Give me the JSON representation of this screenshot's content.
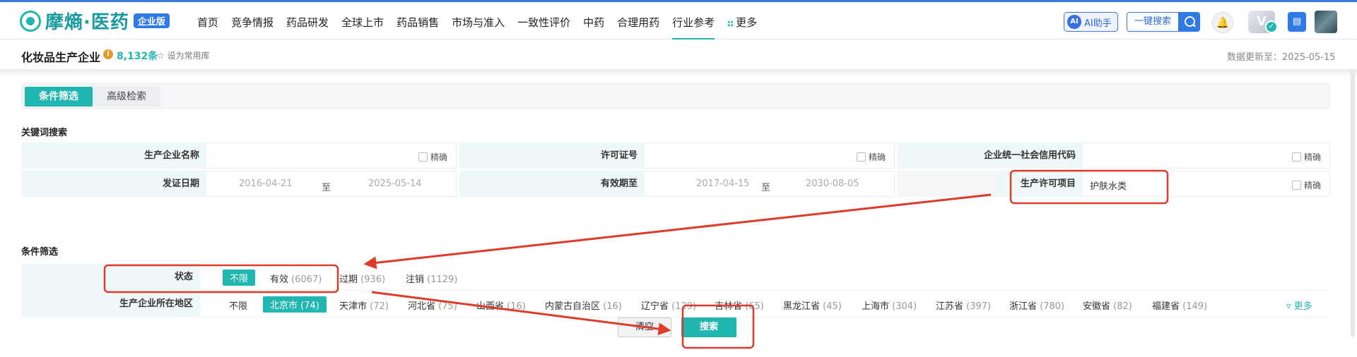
{
  "brand": {
    "name": "摩熵·医药",
    "badge": "企业版"
  },
  "nav": {
    "items": [
      "首页",
      "竞争情报",
      "药品研发",
      "全球上市",
      "药品销售",
      "市场与准入",
      "一致性评价",
      "中药",
      "合理用药",
      "行业参考",
      "更多"
    ],
    "active_index": 9,
    "ai_label": "AI助手",
    "ai_icon_text": "AI",
    "search_label": "一键搜索",
    "vip_text": "V"
  },
  "header": {
    "title": "化妆品生产企业",
    "count": "8,132条",
    "favorite": "设为常用库",
    "updated": "数据更新至：2025-05-15"
  },
  "tabs": [
    "条件筛选",
    "高级检索"
  ],
  "keyword_section": {
    "title": "关键词搜索",
    "exact": "精确",
    "row1": {
      "company_label": "生产企业名称",
      "license_label": "许可证号",
      "credit_label": "企业统一社会信用代码"
    },
    "row2": {
      "issue_label": "发证日期",
      "issue_from": "2016-04-21",
      "issue_to": "2025-05-14",
      "valid_label": "有效期至",
      "valid_from": "2017-04-15",
      "valid_to": "2030-08-05",
      "to": "至",
      "item_label": "生产许可项目",
      "item_value": "护肤水类"
    }
  },
  "filter_section": {
    "title": "条件筛选",
    "status_label": "状态",
    "status_options": [
      {
        "name": "不限",
        "count": ""
      },
      {
        "name": "有效",
        "count": "(6067)"
      },
      {
        "name": "过期",
        "count": "(936)"
      },
      {
        "name": "注销",
        "count": "(1129)"
      }
    ],
    "region_label": "生产企业所在地区",
    "region_options": [
      {
        "name": "不限",
        "count": ""
      },
      {
        "name": "北京市",
        "count": "(74)"
      },
      {
        "name": "天津市",
        "count": "(72)"
      },
      {
        "name": "河北省",
        "count": "(75)"
      },
      {
        "name": "山西省",
        "count": "(16)"
      },
      {
        "name": "内蒙古自治区",
        "count": "(16)"
      },
      {
        "name": "辽宁省",
        "count": "(129)"
      },
      {
        "name": "吉林省",
        "count": "(65)"
      },
      {
        "name": "黑龙江省",
        "count": "(45)"
      },
      {
        "name": "上海市",
        "count": "(304)"
      },
      {
        "name": "江苏省",
        "count": "(397)"
      },
      {
        "name": "浙江省",
        "count": "(780)"
      },
      {
        "name": "安徽省",
        "count": "(82)"
      },
      {
        "name": "福建省",
        "count": "(149)"
      }
    ],
    "more": "更多"
  },
  "actions": {
    "clear": "清空",
    "search": "搜索"
  },
  "colors": {
    "accent": "#21b6b0",
    "annotation": "#e03a2a",
    "brand_blue": "#2f7ae5"
  }
}
